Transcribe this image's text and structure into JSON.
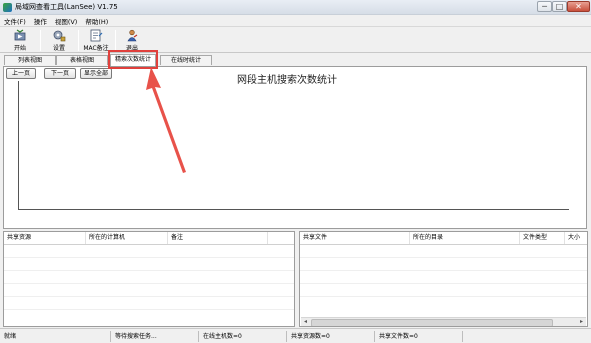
{
  "window": {
    "title": "局域网查看工具(LanSee) V1.75",
    "controls": {
      "minimize": "─",
      "maximize": "□",
      "close": "✕"
    }
  },
  "menu": [
    "文件(F)",
    "操作",
    "视图(V)",
    "帮助(H)"
  ],
  "toolbar": [
    {
      "label": "开始",
      "icon": "play-icon"
    },
    {
      "label": "设置",
      "icon": "settings-icon"
    },
    {
      "label": "MAC备注",
      "icon": "note-icon"
    },
    {
      "label": "退出",
      "icon": "exit-icon"
    }
  ],
  "tabs": [
    {
      "label": "列表视图",
      "active": false
    },
    {
      "label": "表格视图",
      "active": false
    },
    {
      "label": "精索次数统计",
      "active": true
    },
    {
      "label": "在线时统计",
      "active": false
    }
  ],
  "chart_panel": {
    "prev_button": "上一页",
    "next_button": "下一页",
    "show_all_button": "显示全部",
    "title": "网段主机搜索次数统计"
  },
  "share_grid": {
    "columns": [
      "共享资源",
      "所在的计算机",
      "备注"
    ]
  },
  "file_grid": {
    "columns": [
      "共享文件",
      "所在的目录",
      "文件类型",
      "大小"
    ],
    "scroll_left": "◂",
    "scroll_right": "▸"
  },
  "statusbar": {
    "ready": "就绪",
    "task": "等待搜索任务...",
    "online_hosts": "在线主机数=0",
    "shared_resources": "共享资源数=0",
    "shared_files": "共享文件数=0"
  },
  "colors": {
    "highlight": "#e0403c",
    "arrow": "#e8524a"
  }
}
